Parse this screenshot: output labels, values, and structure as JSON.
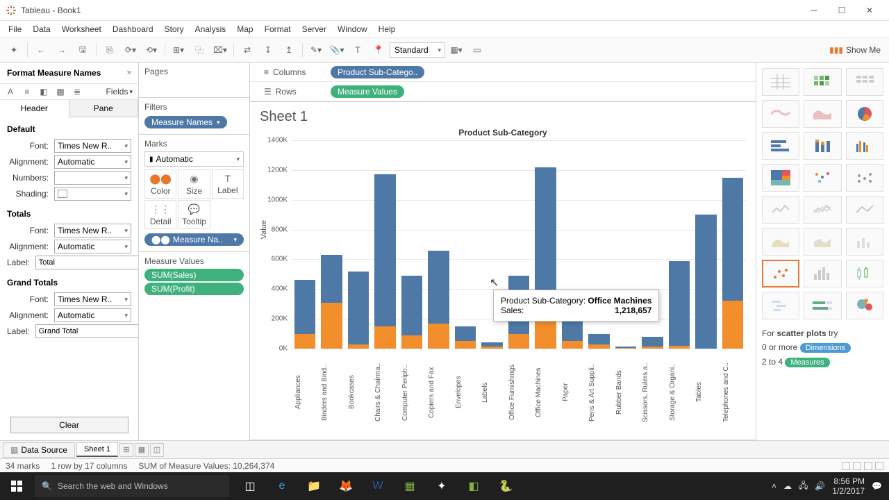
{
  "window": {
    "title": "Tableau - Book1"
  },
  "menu": [
    "File",
    "Data",
    "Worksheet",
    "Dashboard",
    "Story",
    "Analysis",
    "Map",
    "Format",
    "Server",
    "Window",
    "Help"
  ],
  "toolbar": {
    "fit": "Standard",
    "showme": "Show Me"
  },
  "format_pane": {
    "title": "Format Measure Names",
    "fields": "Fields",
    "tabs": {
      "header": "Header",
      "pane": "Pane"
    },
    "section_default": "Default",
    "font_label": "Font:",
    "font_value": "Times New R..",
    "alignment_label": "Alignment:",
    "alignment_value": "Automatic",
    "numbers_label": "Numbers:",
    "shading_label": "Shading:",
    "section_totals": "Totals",
    "totals_label_label": "Label:",
    "totals_label_value": "Total",
    "section_grand": "Grand Totals",
    "grand_label_value": "Grand Total",
    "clear": "Clear"
  },
  "shelves": {
    "pages": "Pages",
    "filters": "Filters",
    "filters_pill": "Measure Names",
    "marks": "Marks",
    "marks_type": "Automatic",
    "mark_cells": [
      "Color",
      "Size",
      "Label",
      "Detail",
      "Tooltip"
    ],
    "marks_pill": "Measure Na..",
    "measure_values": "Measure Values",
    "mv_pills": [
      "SUM(Sales)",
      "SUM(Profit)"
    ],
    "columns": "Columns",
    "columns_pill": "Product Sub-Catego..",
    "rows": "Rows",
    "rows_pill": "Measure Values"
  },
  "viz": {
    "sheet_title": "Sheet 1",
    "chart_title": "Product Sub-Category",
    "y_label": "Value",
    "y_ticks": [
      "0K",
      "200K",
      "400K",
      "600K",
      "800K",
      "1000K",
      "1200K",
      "1400K"
    ]
  },
  "chart_data": {
    "type": "bar",
    "title": "Product Sub-Category",
    "ylabel": "Value",
    "ylim": [
      0,
      1400000
    ],
    "categories": [
      "Appliances",
      "Binders and Bind..",
      "Bookcases",
      "Chairs & Chairma..",
      "Computer Periph..",
      "Copiers and Fax",
      "Envelopes",
      "Labels",
      "Office Furnishings",
      "Office Machines",
      "Paper",
      "Pens & Art Suppli..",
      "Rubber Bands",
      "Scissors, Rulers a..",
      "Storage & Organi..",
      "Tables",
      "Telephones and C.."
    ],
    "series": [
      {
        "name": "SUM(Sales)",
        "color": "#4e79a7",
        "values": [
          460000,
          630000,
          520000,
          1170000,
          490000,
          660000,
          150000,
          40000,
          490000,
          1218657,
          250000,
          100000,
          15000,
          80000,
          590000,
          900000,
          1150000
        ]
      },
      {
        "name": "SUM(Profit)",
        "color": "#f28e2b",
        "values": [
          100000,
          310000,
          30000,
          150000,
          90000,
          170000,
          50000,
          15000,
          100000,
          310000,
          50000,
          30000,
          3000,
          15000,
          20000,
          -10000,
          320000
        ]
      }
    ]
  },
  "tooltip": {
    "cat_label": "Product Sub-Category: ",
    "cat_value": "Office Machines",
    "sales_label": "Sales:",
    "sales_value": "1,218,657"
  },
  "showme_hint": {
    "line1a": "For ",
    "line1b": "scatter plots",
    "line1c": " try",
    "line2a": "0 or more ",
    "chip1": "Dimensions",
    "line3a": "2 to 4 ",
    "chip2": "Measures"
  },
  "tabs": {
    "data_source": "Data Source",
    "sheet1": "Sheet 1"
  },
  "status": {
    "marks": "34 marks",
    "rowcol": "1 row by 17 columns",
    "sum": "SUM of Measure Values: 10,264,374"
  },
  "taskbar": {
    "search_placeholder": "Search the web and Windows",
    "time": "8:56 PM",
    "date": "1/2/2017"
  }
}
